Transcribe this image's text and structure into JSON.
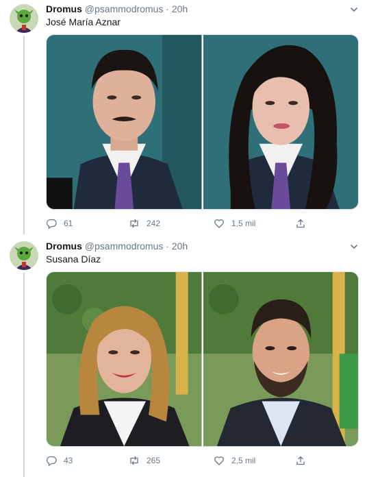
{
  "tweets": [
    {
      "author_name": "Dromus",
      "handle": "@psammodromus",
      "separator": "·",
      "time": "20h",
      "text": "José María Aznar",
      "replies": "61",
      "retweets": "242",
      "likes": "1,5 mil"
    },
    {
      "author_name": "Dromus",
      "handle": "@psammodromus",
      "separator": "·",
      "time": "20h",
      "text": "Susana Díaz",
      "replies": "43",
      "retweets": "265",
      "likes": "2,5 mil"
    }
  ],
  "colors": {
    "text": "#14171a",
    "muted": "#657786",
    "border": "#e1e8ed",
    "thread": "#ccd6dd"
  },
  "icons": [
    "chevron-down-icon",
    "reply-icon",
    "retweet-icon",
    "like-icon",
    "share-icon"
  ]
}
